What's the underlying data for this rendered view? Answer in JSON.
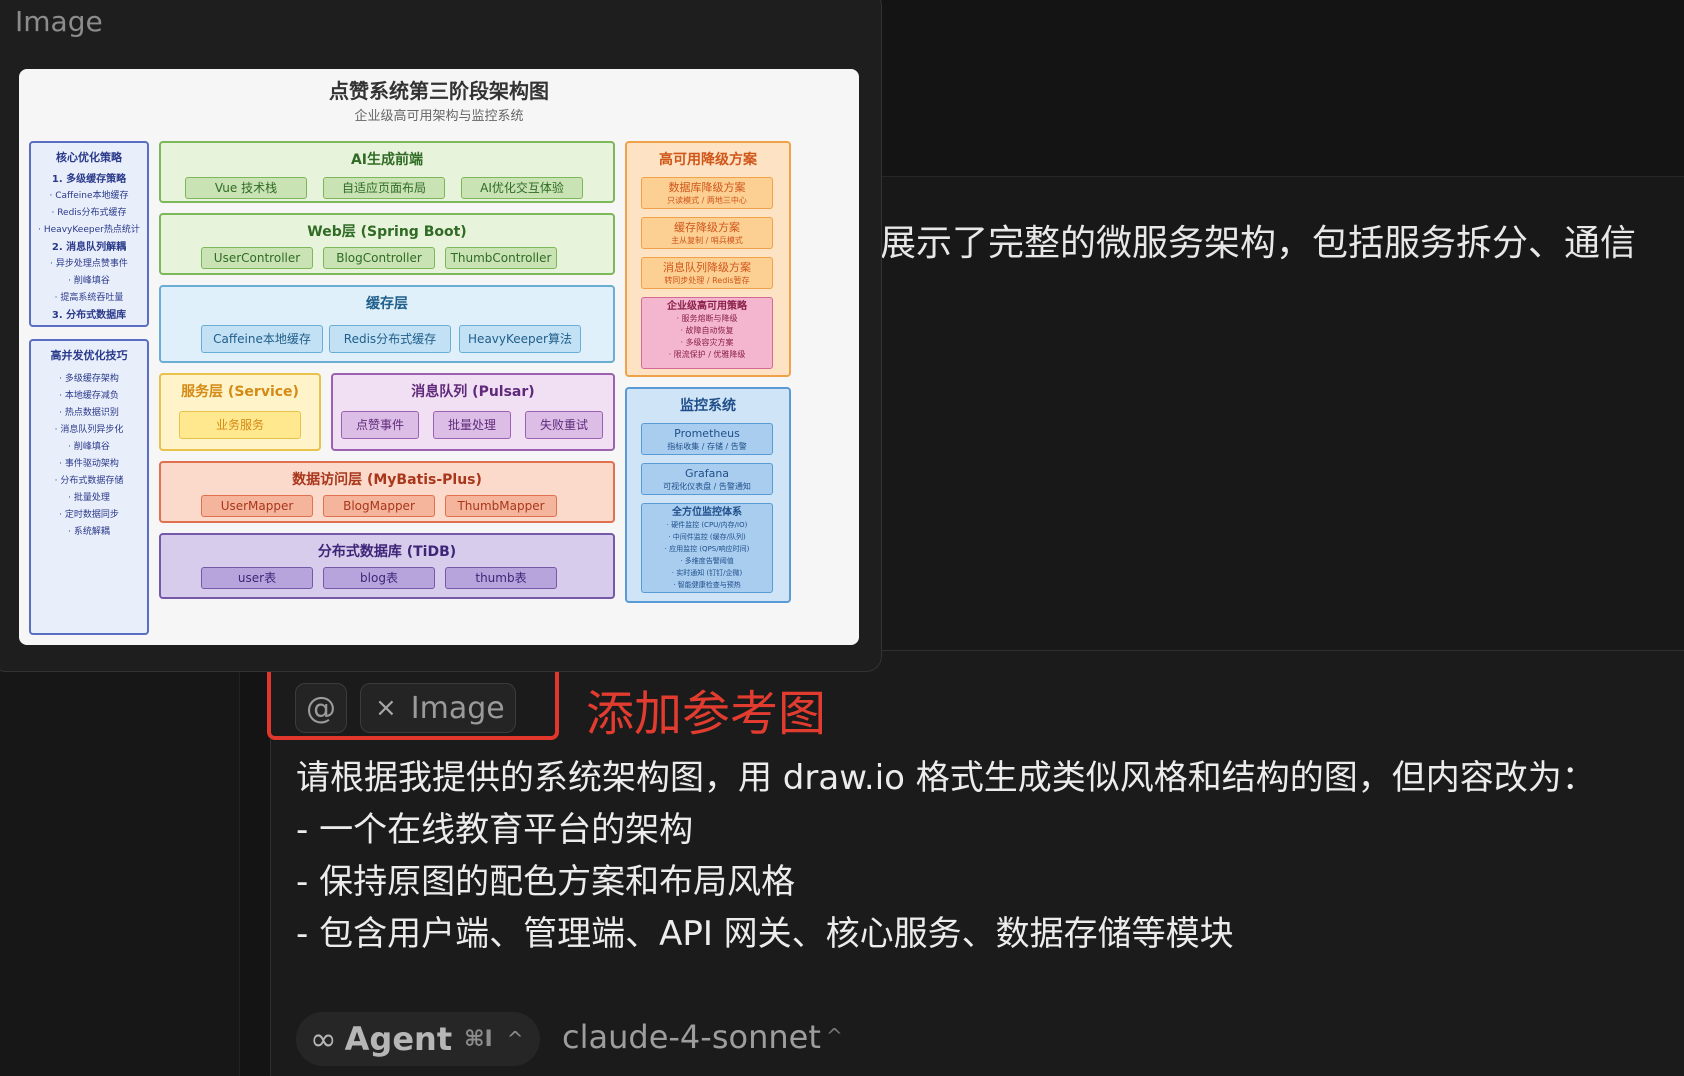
{
  "preview": {
    "header": "Image",
    "diagram": {
      "title": "点赞系统第三阶段架构图",
      "subtitle": "企业级高可用架构与监控系统",
      "left_panel_1": {
        "title": "核心优化策略",
        "lines": [
          {
            "text": "1. 多级缓存策略",
            "head": true
          },
          {
            "text": "· Caffeine本地缓存",
            "head": false
          },
          {
            "text": "· Redis分布式缓存",
            "head": false
          },
          {
            "text": "· HeavyKeeper热点统计",
            "head": false
          },
          {
            "text": "2. 消息队列解耦",
            "head": true
          },
          {
            "text": "· 异步处理点赞事件",
            "head": false
          },
          {
            "text": "· 削峰填谷",
            "head": false
          },
          {
            "text": "· 提高系统吞吐量",
            "head": false
          },
          {
            "text": "3. 分布式数据库",
            "head": true
          }
        ]
      },
      "left_panel_2": {
        "title": "高并发优化技巧",
        "lines": [
          "· 多级缓存架构",
          "· 本地缓存减负",
          "· 热点数据识别",
          "· 消息队列异步化",
          "· 削峰填谷",
          "· 事件驱动架构",
          "· 分布式数据存储",
          "· 批量处理",
          "· 定时数据同步",
          "· 系统解耦"
        ]
      },
      "frontend": {
        "title": "AI生成前端",
        "items": [
          "Vue 技术栈",
          "自适应页面布局",
          "AI优化交互体验"
        ]
      },
      "web": {
        "title": "Web层 (Spring Boot)",
        "items": [
          "UserController",
          "BlogController",
          "ThumbController"
        ]
      },
      "cache": {
        "title": "缓存层",
        "items": [
          "Caffeine本地缓存",
          "Redis分布式缓存",
          "HeavyKeeper算法"
        ]
      },
      "service": {
        "title": "服务层 (Service)",
        "items": [
          "业务服务"
        ]
      },
      "mq": {
        "title": "消息队列 (Pulsar)",
        "items": [
          "点赞事件",
          "批量处理",
          "失败重试"
        ]
      },
      "dao": {
        "title": "数据访问层 (MyBatis-Plus)",
        "items": [
          "UserMapper",
          "BlogMapper",
          "ThumbMapper"
        ]
      },
      "db": {
        "title": "分布式数据库 (TiDB)",
        "items": [
          "user表",
          "blog表",
          "thumb表"
        ]
      },
      "ha": {
        "title": "高可用降级方案",
        "items": [
          {
            "name": "数据库降级方案",
            "desc": "只读模式 / 两地三中心"
          },
          {
            "name": "缓存降级方案",
            "desc": "主从复制 / 哨兵模式"
          },
          {
            "name": "消息队列降级方案",
            "desc": "转同步处理 / Redis暂存"
          }
        ],
        "enterprise": {
          "name": "企业级高可用策略",
          "lines": [
            "· 服务熔断与降级",
            "· 故障自动恢复",
            "· 多级容灾方案",
            "· 限流保护 / 优雅降级"
          ]
        }
      },
      "monitor": {
        "title": "监控系统",
        "items": [
          {
            "name": "Prometheus",
            "desc": "指标收集 / 存储 / 告警"
          },
          {
            "name": "Grafana",
            "desc": "可视化仪表盘 / 告警通知"
          }
        ],
        "full": {
          "name": "全方位监控体系",
          "lines": [
            "· 硬件监控 (CPU/内存/IO)",
            "· 中间件监控 (缓存/队列)",
            "· 应用监控 (QPS/响应时间)",
            "· 多维度告警阈值",
            "· 实时通知 (钉钉/企微)",
            "· 智能健康检查与预热"
          ]
        }
      }
    }
  },
  "background_message": "展示了完整的微服务架构，包括服务拆分、通信",
  "composer": {
    "mention_symbol": "@",
    "chip_close": "×",
    "chip_label": "Image",
    "annotation": "添加参考图",
    "prompt_lines": [
      "请根据我提供的系统架构图，用 draw.io 格式生成类似风格和结构的图，但内容改为：",
      "- 一个在线教育平台的架构",
      "- 保持原图的配色方案和布局风格",
      "- 包含用户端、管理端、API 网关、核心服务、数据存储等模块"
    ],
    "agent_icon": "∞",
    "agent_label": "Agent",
    "agent_shortcut": "⌘I",
    "agent_chevron": "^",
    "model_label": "claude-4-sonnet",
    "model_chevron": "^"
  },
  "colors": {
    "annotation_red": "#e1362b",
    "green_box": "#e8f3dc",
    "blue_box": "#dff0fb",
    "yellow_box": "#fff4c9",
    "purple_box": "#f1e0f4",
    "salmon_box": "#fbd9cb",
    "lavender_box": "#d8ccec",
    "orange_box": "#fde3c3",
    "monitor_box": "#cfe4f7"
  }
}
